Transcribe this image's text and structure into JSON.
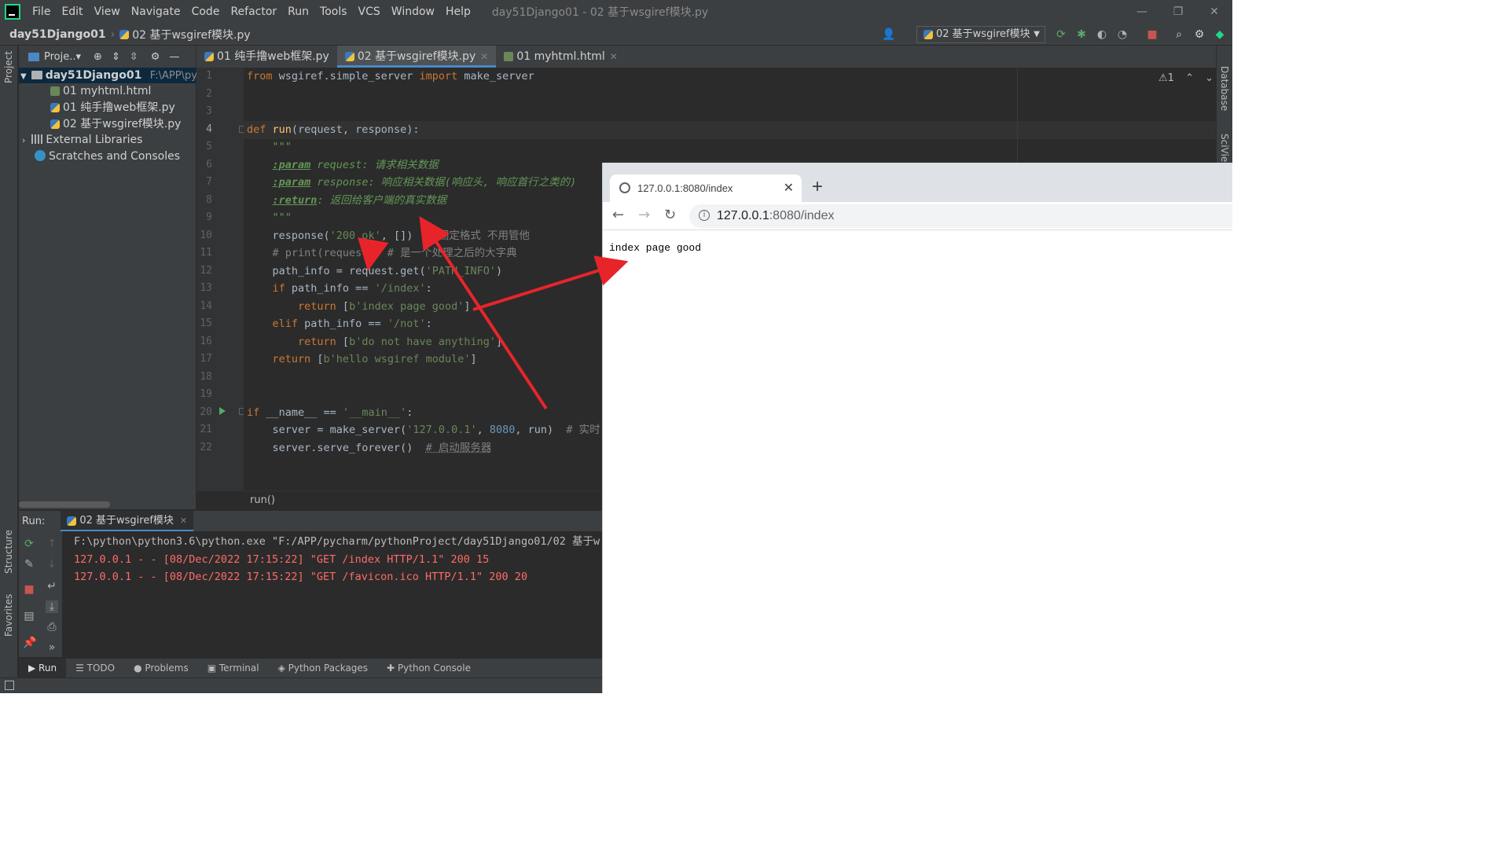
{
  "window": {
    "title": "day51Django01 - 02 基于wsgiref模块.py",
    "menu": [
      "File",
      "Edit",
      "View",
      "Navigate",
      "Code",
      "Refactor",
      "Run",
      "Tools",
      "VCS",
      "Window",
      "Help"
    ],
    "controls": {
      "minimize": "—",
      "restore": "❐",
      "close": "✕"
    }
  },
  "navbar": {
    "project": "day51Django01",
    "file": "02 基于wsgiref模块.py",
    "run_config": "02 基于wsgiref模块"
  },
  "left_strip": {
    "project_label": "Project",
    "structure_label": "Structure",
    "favorites_label": "Favorites"
  },
  "right_strip": {
    "database_label": "Database",
    "sciview_label": "SciView"
  },
  "project_panel": {
    "header": "Proje..▾",
    "tree": [
      {
        "label": "day51Django01",
        "path": "F:\\APP\\pycha",
        "type": "folder"
      },
      {
        "label": "01 myhtml.html",
        "type": "html"
      },
      {
        "label": "01 纯手撸web框架.py",
        "type": "py"
      },
      {
        "label": "02 基于wsgiref模块.py",
        "type": "py"
      },
      {
        "label": "External Libraries",
        "type": "lib"
      },
      {
        "label": "Scratches and Consoles",
        "type": "scratch"
      }
    ]
  },
  "editor": {
    "tabs": [
      {
        "label": "01 纯手撸web框架.py",
        "active": false
      },
      {
        "label": "02 基于wsgiref模块.py",
        "active": true
      },
      {
        "label": "01 myhtml.html",
        "active": false
      }
    ],
    "inspection": "⚠1",
    "breadcrumb": "run()",
    "line_numbers": [
      "1",
      "2",
      "3",
      "4",
      "5",
      "6",
      "7",
      "8",
      "9",
      "10",
      "11",
      "12",
      "13",
      "14",
      "15",
      "16",
      "17",
      "18",
      "19",
      "20",
      "21",
      "22"
    ],
    "code": {
      "l1_kw1": "from",
      "l1_mod": " wsgiref.simple_server ",
      "l1_kw2": "import",
      "l1_name": " make_server",
      "l4_kw": "def",
      "l4_fn": " run",
      "l4_args": "(request, response):",
      "l5": "    \"\"\"",
      "l6_tag": ":param",
      "l6_text": " request: 请求相关数据",
      "l7_tag": ":param",
      "l7_text": " response: 响应相关数据(响应头, 响应首行之类的)",
      "l8_tag": ":return",
      "l8_text": ": 返回给客户端的真实数据",
      "l9": "    \"\"\"",
      "l10_a": "    response(",
      "l10_str": "'200 ok'",
      "l10_b": ", [])  ",
      "l10_cmt": "# 固定格式 不用管他",
      "l11": "    # print(request)  # 是一个处理之后的大字典",
      "l12_a": "    path_info = request.get(",
      "l12_str": "'PATH_INFO'",
      "l12_b": ")",
      "l13_kw": "    if",
      "l13_a": " path_info == ",
      "l13_str": "'/index'",
      "l13_b": ":",
      "l14_kw": "        return",
      "l14_a": " [",
      "l14_str": "b'index page good'",
      "l14_b": "]",
      "l15_kw": "    elif",
      "l15_a": " path_info == ",
      "l15_str": "'/not'",
      "l15_b": ":",
      "l16_kw": "        return",
      "l16_a": " [",
      "l16_str": "b'do not have anything'",
      "l16_b": "]",
      "l17_kw": "    return",
      "l17_a": " [",
      "l17_str": "b'hello wsgiref module'",
      "l17_b": "]",
      "l20_kw": "if",
      "l20_a": " __name__ == ",
      "l20_str": "'__main__'",
      "l20_b": ":",
      "l21_a": "    server = make_server(",
      "l21_str": "'127.0.0.1'",
      "l21_b": ", ",
      "l21_num": "8080",
      "l21_c": ", run)  ",
      "l21_cmt": "# 实时",
      "l22_a": "    server.serve_forever()  ",
      "l22_cmt": "# 启动服务器"
    }
  },
  "run_panel": {
    "label": "Run:",
    "tab": "02 基于wsgiref模块",
    "output": [
      {
        "text": "F:\\python\\python3.6\\python.exe \"F:/APP/pycharm/pythonProject/day51Django01/02 基于w",
        "kind": "normal"
      },
      {
        "text": "127.0.0.1 - - [08/Dec/2022 17:15:22] \"GET /index HTTP/1.1\" 200 15",
        "kind": "err"
      },
      {
        "text": "127.0.0.1 - - [08/Dec/2022 17:15:22] \"GET /favicon.ico HTTP/1.1\" 200 20",
        "kind": "err"
      }
    ]
  },
  "bottom_tabs": [
    "Run",
    "TODO",
    "Problems",
    "Terminal",
    "Python Packages",
    "Python Console"
  ],
  "browser": {
    "tab_title": "127.0.0.1:8080/index",
    "url_host": "127.0.0.1",
    "url_rest": ":8080/index",
    "new_tab": "+",
    "content": "index page good"
  },
  "colors": {
    "annotation_arrow": "#e8242b",
    "ide_bg": "#2b2b2b",
    "panel_bg": "#3c3f41",
    "keyword": "#cc7832",
    "string": "#6a8759"
  }
}
